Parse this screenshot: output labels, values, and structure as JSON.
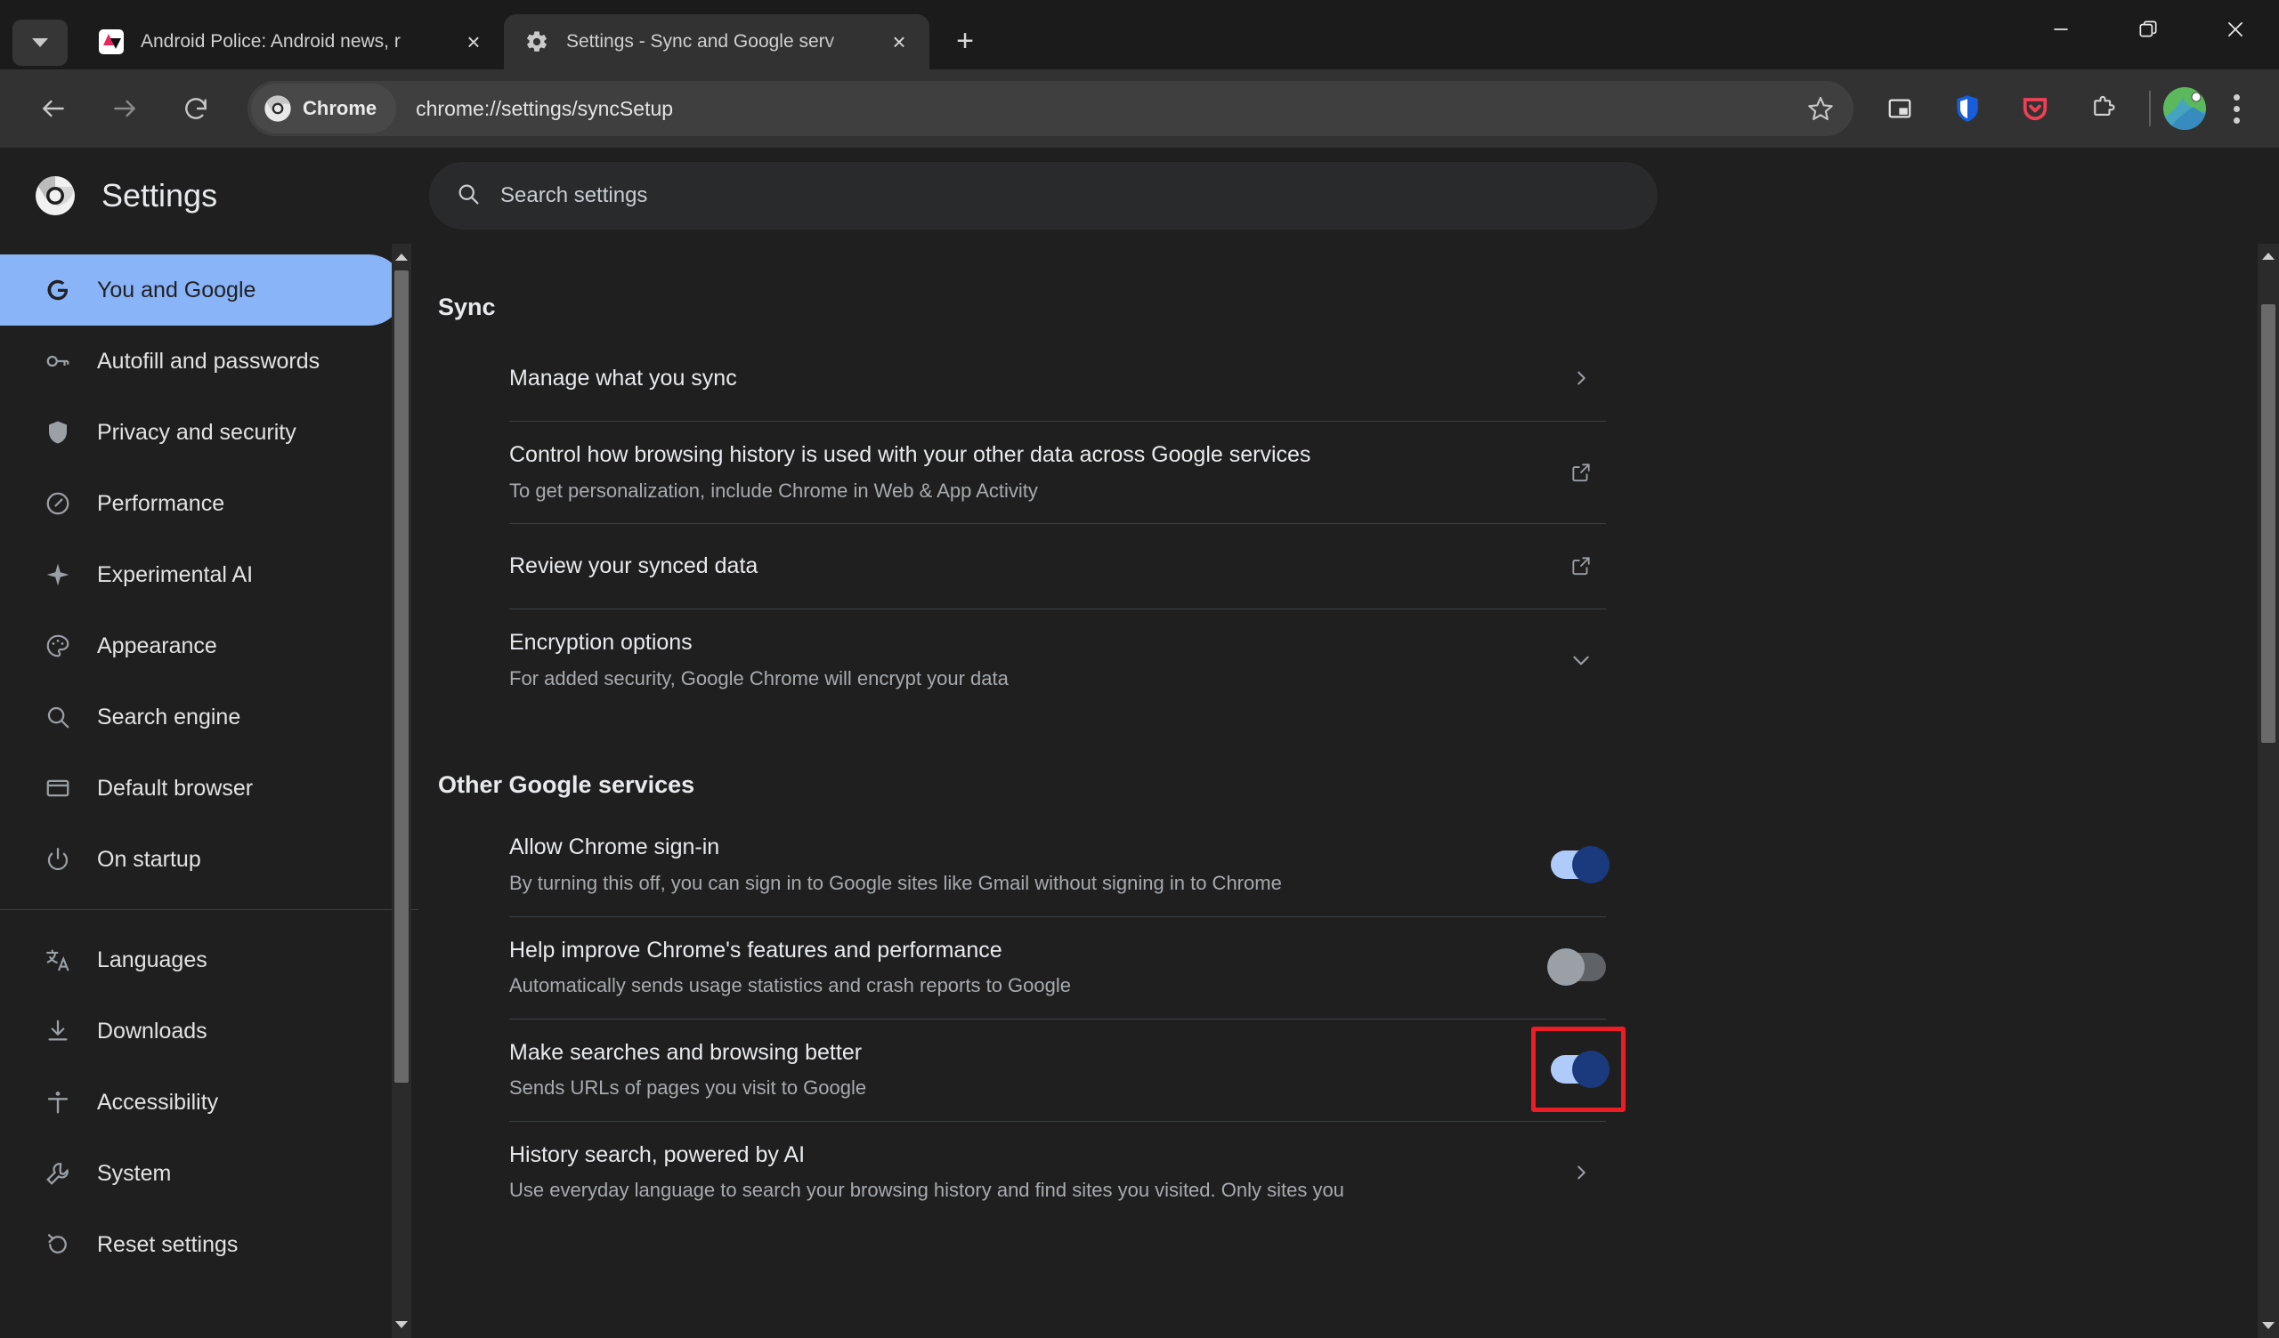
{
  "window": {
    "minimize_label": "Minimize",
    "restore_label": "Restore",
    "close_label": "Close"
  },
  "tabstrip": {
    "tab_search_tooltip": "Search tabs",
    "new_tab_label": "+",
    "tabs": [
      {
        "title": "Android Police: Android news, r",
        "favicon": "android-police-icon",
        "active": false,
        "close_label": "×"
      },
      {
        "title": "Settings - Sync and Google serv",
        "favicon": "gear-icon",
        "active": true,
        "close_label": "×"
      }
    ]
  },
  "toolbar": {
    "back_label": "Back",
    "forward_label": "Forward",
    "reload_label": "Reload",
    "chrome_chip_label": "Chrome",
    "url": "chrome://settings/syncSetup",
    "bookmark_label": "Bookmark this tab",
    "icons": [
      {
        "name": "picture-in-picture-icon",
        "title": "Picture in picture"
      },
      {
        "name": "bitwarden-shield-icon",
        "title": "Bitwarden",
        "color": "#175DDC"
      },
      {
        "name": "pocket-icon",
        "title": "Save to Pocket",
        "color": "#EF4056"
      },
      {
        "name": "extensions-puzzle-icon",
        "title": "Extensions"
      }
    ],
    "avatar_label": "Profile",
    "menu_label": "Customize and control Google Chrome"
  },
  "settings": {
    "brand_title": "Settings",
    "brand_icon": "chrome-logo-icon",
    "search": {
      "placeholder": "Search settings",
      "value": "",
      "icon": "search-icon"
    }
  },
  "sidebar": {
    "groups": [
      {
        "items": [
          {
            "label": "You and Google",
            "icon": "google-g-icon",
            "selected": true
          },
          {
            "label": "Autofill and passwords",
            "icon": "key-icon",
            "selected": false
          },
          {
            "label": "Privacy and security",
            "icon": "shield-icon",
            "selected": false
          },
          {
            "label": "Performance",
            "icon": "speedometer-icon",
            "selected": false
          },
          {
            "label": "Experimental AI",
            "icon": "sparkle-icon",
            "selected": false
          },
          {
            "label": "Appearance",
            "icon": "palette-icon",
            "selected": false
          },
          {
            "label": "Search engine",
            "icon": "magnifier-icon",
            "selected": false
          },
          {
            "label": "Default browser",
            "icon": "browser-window-icon",
            "selected": false
          },
          {
            "label": "On startup",
            "icon": "power-icon",
            "selected": false
          }
        ]
      },
      {
        "items": [
          {
            "label": "Languages",
            "icon": "translate-icon",
            "selected": false
          },
          {
            "label": "Downloads",
            "icon": "download-icon",
            "selected": false
          },
          {
            "label": "Accessibility",
            "icon": "accessibility-icon",
            "selected": false
          },
          {
            "label": "System",
            "icon": "wrench-icon",
            "selected": false
          },
          {
            "label": "Reset settings",
            "icon": "restore-icon",
            "selected": false
          }
        ]
      }
    ]
  },
  "main": {
    "sections": [
      {
        "title": "Sync",
        "rows": [
          {
            "title": "Manage what you sync",
            "sub": "",
            "action": "chevron-right-icon"
          },
          {
            "title": "Control how browsing history is used with your other data across Google services",
            "sub": "To get personalization, include Chrome in Web & App Activity",
            "action": "open-in-new-icon"
          },
          {
            "title": "Review your synced data",
            "sub": "",
            "action": "open-in-new-icon"
          },
          {
            "title": "Encryption options",
            "sub": "For added security, Google Chrome will encrypt your data",
            "action": "chevron-down-icon"
          }
        ]
      },
      {
        "title": "Other Google services",
        "rows": [
          {
            "title": "Allow Chrome sign-in",
            "sub": "By turning this off, you can sign in to Google sites like Gmail without signing in to Chrome",
            "action": "toggle",
            "toggle_state": "on",
            "highlighted": false
          },
          {
            "title": "Help improve Chrome's features and performance",
            "sub": "Automatically sends usage statistics and crash reports to Google",
            "action": "toggle",
            "toggle_state": "off",
            "highlighted": false
          },
          {
            "title": "Make searches and browsing better",
            "sub": "Sends URLs of pages you visit to Google",
            "action": "toggle",
            "toggle_state": "on",
            "highlighted": true
          },
          {
            "title": "History search, powered by AI",
            "sub": "Use everyday language to search your browsing history and find sites you visited. Only sites you",
            "action": "chevron-right-icon"
          }
        ]
      }
    ]
  },
  "colors": {
    "accent_blue": "#8ab4f8",
    "toggle_on_track": "#aecbfa",
    "toggle_on_knob": "#1a3a7d",
    "toggle_off_track": "#5f6368",
    "highlight_red": "#ee1c25",
    "page_bg": "#1f1f1f",
    "toolbar_bg": "#323232"
  }
}
